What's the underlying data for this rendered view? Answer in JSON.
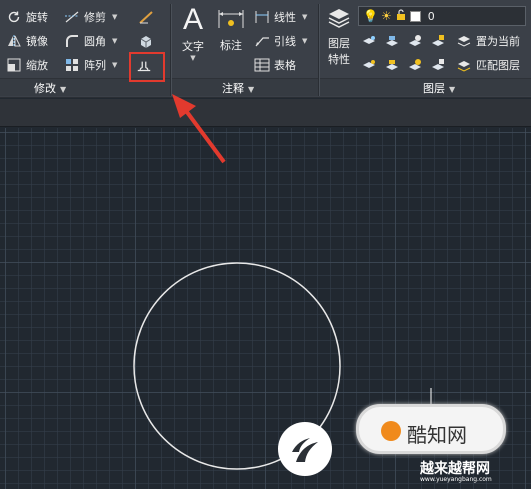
{
  "ribbon": {
    "modify": {
      "title": "修改",
      "rotate": "旋转",
      "mirror": "镜像",
      "scale": "缩放",
      "trim": "修剪",
      "fillet": "圆角",
      "array": "阵列"
    },
    "annotation": {
      "title": "注释",
      "text": "文字",
      "dimension": "标注",
      "linear": "线性",
      "leader": "引线",
      "table": "表格"
    },
    "layers": {
      "title": "图层",
      "layer_properties_line1": "图层",
      "layer_properties_line2": "特性",
      "current_layer": "0",
      "set_current": "置为当前",
      "match_layer": "匹配图层"
    }
  },
  "colors": {
    "ribbon_bg": "#3b4048",
    "canvas_bg": "#212830",
    "highlight": "#e23a2e",
    "circle_stroke": "#e8e8e8"
  },
  "watermark": {
    "brand_cn": "酷知网",
    "site_cn": "越来越帮网",
    "site_url": "www.yueyangbang.com"
  }
}
